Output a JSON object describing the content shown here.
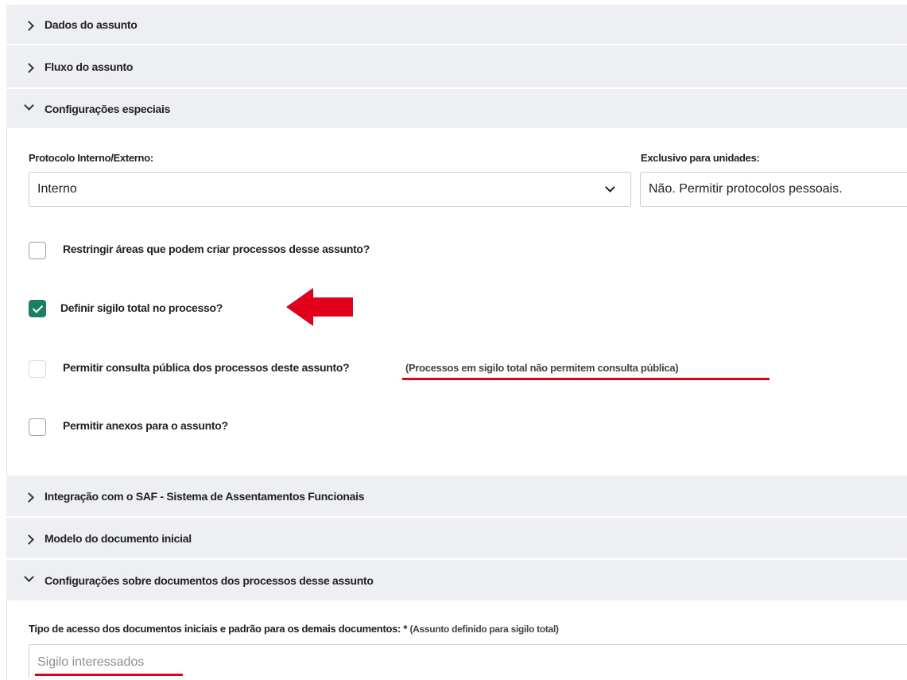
{
  "accordion": {
    "dados": {
      "label": "Dados do assunto"
    },
    "fluxo": {
      "label": "Fluxo do assunto"
    },
    "config": {
      "label": "Configurações especiais"
    },
    "saf": {
      "label": "Integração com o SAF - Sistema de Assentamentos Funcionais"
    },
    "modelo": {
      "label": "Modelo do documento inicial"
    },
    "documentos": {
      "label": "Configurações sobre documentos dos processos desse assunto"
    }
  },
  "config": {
    "protocolo_label": "Protocolo Interno/Externo:",
    "protocolo_value": "Interno",
    "exclusivo_label": "Exclusivo para unidades:",
    "exclusivo_value": "Não. Permitir protocolos pessoais.",
    "checkboxes": [
      {
        "label": "Restringir áreas que podem criar processos desse assunto?",
        "checked": false
      },
      {
        "label": "Definir sigilo total no processo?",
        "checked": true
      },
      {
        "label": "Permitir consulta pública dos processos deste assunto?",
        "checked": false,
        "note": "(Processos em sigilo total não permitem consulta pública)"
      },
      {
        "label": "Permitir anexos para o assunto?",
        "checked": false
      }
    ]
  },
  "documentos": {
    "tipo_label": "Tipo de acesso dos documentos iniciais e padrão para os demais documentos:",
    "required_mark": "*",
    "tipo_note": "(Assunto definido para sigilo total)",
    "tipo_value": "Sigilo interessados"
  },
  "colors": {
    "accent_check": "#1a7f64",
    "annotation_red": "#e3001b"
  }
}
